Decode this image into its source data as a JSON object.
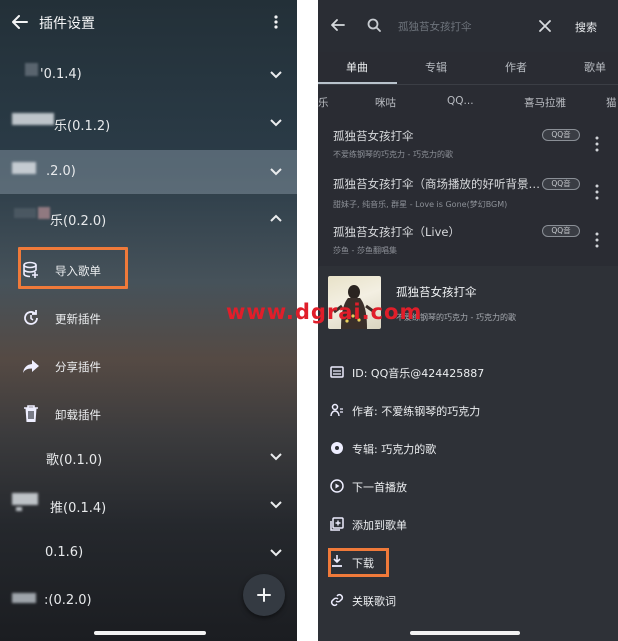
{
  "left": {
    "title": "插件设置",
    "plugins": [
      {
        "label": "'0.1.4)"
      },
      {
        "label": "乐(0.1.2)"
      },
      {
        "label": ".2.0)"
      },
      {
        "label": "乐(0.2.0)"
      },
      {
        "label": "歌(0.1.0)"
      },
      {
        "label": "推(0.1.4)"
      },
      {
        "label": "0.1.6)"
      },
      {
        "label": ":(0.2.0)"
      }
    ],
    "submenu": [
      {
        "label": "导入歌单",
        "icon": "database-icon"
      },
      {
        "label": "更新插件",
        "icon": "refresh-icon"
      },
      {
        "label": "分享插件",
        "icon": "share-icon"
      },
      {
        "label": "卸载插件",
        "icon": "trash-icon"
      }
    ],
    "fab": "+"
  },
  "right": {
    "search": {
      "placeholder": "孤独苔女孩打伞",
      "button": "搜索"
    },
    "tabs": [
      "单曲",
      "专辑",
      "作者",
      "歌单"
    ],
    "chips": [
      "乐",
      "咪咕",
      "QQ...",
      "喜马拉雅",
      "猫"
    ],
    "songs": [
      {
        "title": "孤独苔女孩打伞",
        "subtitle": "不爱练钢琴的巧克力 - 巧克力的歌",
        "badge": "QQ音"
      },
      {
        "title": "孤独苔女孩打伞（商场播放的好听背景…",
        "subtitle": "甜妹子, 纯音乐, 群星 - Love is Gone(梦幻BGM)",
        "badge": "QQ音"
      },
      {
        "title": "孤独苔女孩打伞（Live）",
        "subtitle": "莎鱼 - 莎鱼翻唱集",
        "badge": "QQ音"
      }
    ],
    "sheet": {
      "title": "孤独苔女孩打伞",
      "subtitle": "不爱练钢琴的巧克力 - 巧克力的歌",
      "watermark": "www.dgrai.com",
      "items": [
        {
          "label": "ID: QQ音乐@424425887",
          "icon": "card-icon"
        },
        {
          "label": "作者: 不爱练钢琴的巧克力",
          "icon": "person-icon"
        },
        {
          "label": "专辑: 巧克力的歌",
          "icon": "disc-icon"
        },
        {
          "label": "下一首播放",
          "icon": "play-next-icon"
        },
        {
          "label": "添加到歌单",
          "icon": "add-playlist-icon"
        },
        {
          "label": "下载",
          "icon": "download-icon"
        },
        {
          "label": "关联歌词",
          "icon": "link-icon"
        }
      ]
    }
  },
  "colors": {
    "highlight": "#f07a3a",
    "watermark": "#e01e2a"
  }
}
